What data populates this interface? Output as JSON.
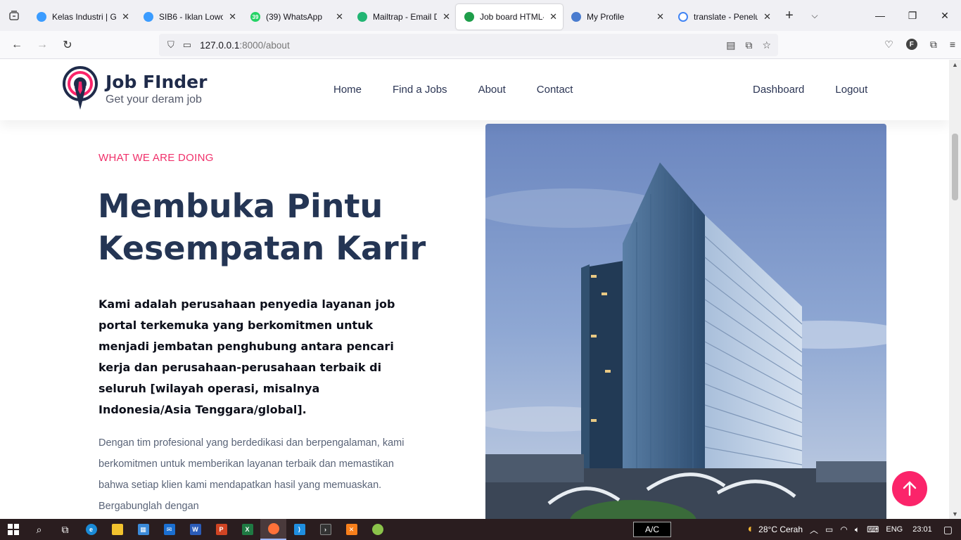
{
  "browser": {
    "tabs": [
      {
        "title": "Kelas Industri | Ga",
        "fav_color": "#3b9cff",
        "active": false
      },
      {
        "title": "SIB6 - Iklan Lowor",
        "fav_color": "#3b9cff",
        "active": false
      },
      {
        "title": "(39) WhatsApp",
        "fav_color": "#25d366",
        "fav_text": "39",
        "active": false
      },
      {
        "title": "Mailtrap - Email D",
        "fav_color": "#22b573",
        "active": false
      },
      {
        "title": "Job board HTML-",
        "fav_color": "#1e9e4a",
        "active": true
      },
      {
        "title": "My Profile",
        "fav_color": "#4a7ccf",
        "active": false
      },
      {
        "title": "translate - Penelu",
        "fav_color": "#ffffff",
        "active": false
      }
    ],
    "url_host": "127.0.0.1",
    "url_rest": ":8000/about"
  },
  "site": {
    "brand_name": "Job FInder",
    "brand_tagline": "Get your deram job",
    "menu": [
      "Home",
      "Find a Jobs",
      "About",
      "Contact"
    ],
    "menu_right": [
      "Dashboard",
      "Logout"
    ],
    "accent": "#fb246a",
    "navy": "#243554"
  },
  "about": {
    "eyebrow": "WHAT WE ARE DOING",
    "headline": "Membuka Pintu Kesempatan Karir",
    "lead": "Kami adalah perusahaan penyedia layanan job portal terkemuka yang berkomitmen untuk menjadi jembatan penghubung antara pencari kerja dan perusahaan-perusahaan terbaik di seluruh [wilayah operasi, misalnya Indonesia/Asia Tenggara/global].",
    "body": "Dengan tim profesional yang berdedikasi dan berpengalaman, kami berkomitmen untuk memberikan layanan terbaik dan memastikan bahwa setiap klien kami mendapatkan hasil yang memuaskan. Bergabunglah dengan"
  },
  "taskbar": {
    "ac_label": "A/C",
    "weather": "28°C  Cerah",
    "lang": "ENG",
    "time": "23:01"
  }
}
